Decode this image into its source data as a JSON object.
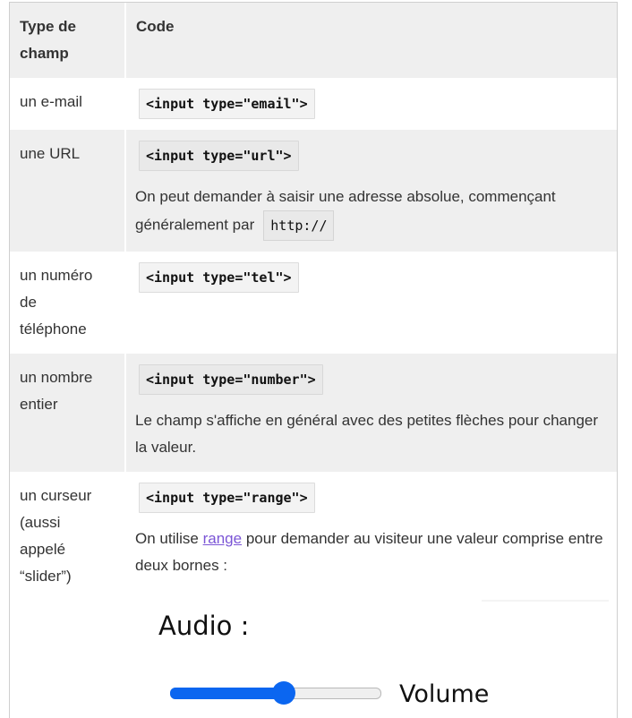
{
  "table": {
    "headers": {
      "type": "Type de champ",
      "code": "Code"
    },
    "rows": [
      {
        "type": "un e-mail",
        "code": "<input type=\"email\">"
      },
      {
        "type": "une URL",
        "code": "<input type=\"url\">",
        "desc": "On peut demander à saisir une adresse absolue, commençant généralement par",
        "desc_code": "http://"
      },
      {
        "type": "un numéro de téléphone",
        "code": "<input type=\"tel\">"
      },
      {
        "type": "un nombre entier",
        "code": "<input type=\"number\">",
        "desc": "Le champ s'affiche en général avec des petites flèches pour changer la valeur."
      },
      {
        "type": "un curseur (aussi appelé “slider”)",
        "code": "<input type=\"range\">",
        "desc_before": "On utilise",
        "desc_link": "range",
        "desc_after": "pour demander au visiteur une valeur comprise entre deux bornes :"
      }
    ]
  },
  "demo": {
    "title": "Audio :",
    "slider_label": "Volume",
    "slider_value_fraction": 0.54,
    "accent_color": "#0b66f0"
  }
}
